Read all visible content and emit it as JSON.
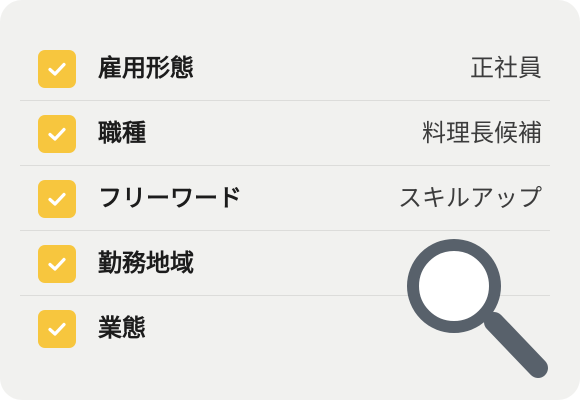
{
  "filters": [
    {
      "label": "雇用形態",
      "value": "正社員",
      "checked": true
    },
    {
      "label": "職種",
      "value": "料理長候補",
      "checked": true
    },
    {
      "label": "フリーワード",
      "value": "スキルアップ",
      "checked": true
    },
    {
      "label": "勤務地域",
      "value": "",
      "checked": true
    },
    {
      "label": "業態",
      "value": "",
      "checked": true
    }
  ],
  "icons": {
    "checkbox": "checkmark-icon",
    "search": "magnifier-icon"
  },
  "colors": {
    "card_background": "#f1f1ef",
    "checkbox_fill": "#f7c63e",
    "magnifier_stroke": "#58616b"
  }
}
